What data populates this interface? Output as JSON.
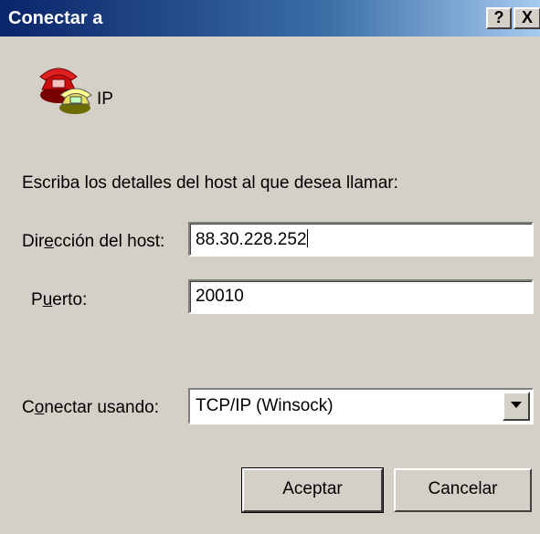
{
  "window": {
    "title": "Conectar a",
    "help_button": "?",
    "close_button": "X"
  },
  "connection": {
    "name": "IP",
    "icon": "phone-icon"
  },
  "instructions": "Escriba los detalles del host al que desea llamar:",
  "host": {
    "label_prefix": "Dir",
    "label_accel": "e",
    "label_suffix": "cción del host:",
    "value": "88.30.228.252"
  },
  "port": {
    "label_prefix": "P",
    "label_accel": "u",
    "label_suffix": "erto:",
    "value": "20010"
  },
  "connect_using": {
    "label_prefix": "C",
    "label_accel": "o",
    "label_suffix": "nectar usando:",
    "value": "TCP/IP (Winsock)"
  },
  "buttons": {
    "ok": "Aceptar",
    "cancel": "Cancelar"
  }
}
